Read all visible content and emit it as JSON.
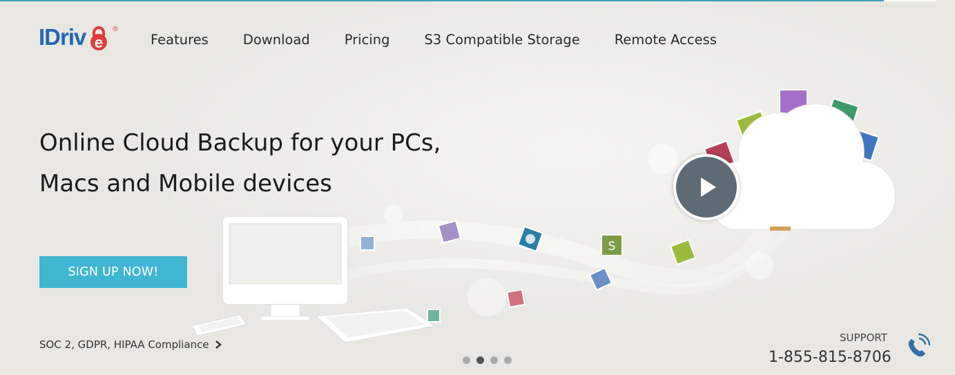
{
  "header": {
    "logo_text": "IDriv",
    "logo_e": "e",
    "logo_reg": "®",
    "nav": [
      "Features",
      "Download",
      "Pricing",
      "S3 Compatible Storage",
      "Remote Access"
    ]
  },
  "hero": {
    "headline_line1": "Online Cloud Backup for your PCs,",
    "headline_line2": "Macs and Mobile devices",
    "signup_label": "SIGN UP NOW!",
    "compliance_text": "SOC 2, GDPR, HIPAA Compliance"
  },
  "carousel": {
    "slide_count": 4,
    "active_index": 1
  },
  "support": {
    "label": "SUPPORT",
    "phone": "1-855-815-8706"
  },
  "icons": {
    "play": "play-icon",
    "phone": "phone-icon",
    "chevron": "chevron-right-icon"
  },
  "colors": {
    "brand_blue": "#2168b4",
    "brand_red": "#e23b3b",
    "button": "#41b6d1",
    "accent_line": "#3aa0c4"
  }
}
